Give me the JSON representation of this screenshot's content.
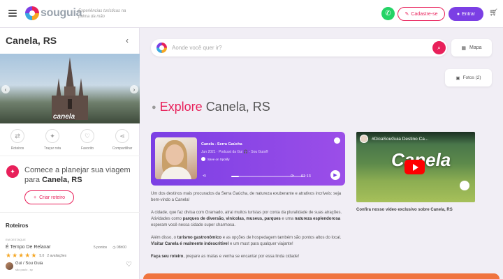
{
  "header": {
    "logo_text": "souguia",
    "tagline": "Experiências turísticas na palma da mão",
    "signup_label": "Cadastre-se",
    "login_label": "Entrar"
  },
  "sidebar": {
    "city_title": "Canela, RS",
    "hero_caption": "canela",
    "actions": [
      {
        "label": "Roteiros",
        "icon": "route-icon"
      },
      {
        "label": "Traçar rota",
        "icon": "compass-icon"
      },
      {
        "label": "Favorito",
        "icon": "heart-icon"
      },
      {
        "label": "Compartilhar",
        "icon": "share-icon"
      }
    ],
    "plan_prefix": "Comece a planejar sua viagem para ",
    "plan_city": "Canela, RS",
    "create_route_label": "Criar roteiro",
    "routes_title": "Roteiros",
    "route": {
      "highlight": "EM DESTAQUE",
      "name": "É Tempo De Relaxar",
      "points": "5 pontos",
      "duration": "08h00",
      "rating": "5.0",
      "reviews": "2 avaliações",
      "author": "Gui / Sou Guia",
      "location": "são paulo , sp"
    }
  },
  "main": {
    "search_placeholder": "Aonde você quer ir?",
    "map_label": "Mapa",
    "photos_label": "Fotos (2)",
    "explore_word": "Explore",
    "explore_city": "Canela, RS",
    "podcast": {
      "title": "Canela - Serra Gaúcha",
      "subtitle": "Jun 2021 · Podcast da Gui 🎧 - Sou Guia®",
      "save_label": "Save on Spotify",
      "duration": "01:13",
      "progress": 0.1
    },
    "video": {
      "title": "#DicaSouGuia Destino Ca...",
      "big_text": "Canela",
      "caption": "Confira nosso vídeo exclusivo sobre Canela, RS"
    },
    "description": {
      "p1": "Um dos destinos mais procurados da Serra Gaúcha, de natureza exuberante e atrativos incríveis: seja bem-vindo a Canela!",
      "p2_a": "A cidade, que faz divisa com Gramado, atrai muitos turistas por conta da pluralidade de suas atrações. Atividades como ",
      "p2_b": "parques de diversão, vinícolas, museus, parques",
      "p2_c": " e uma ",
      "p2_d": "natureza esplendorosa",
      "p2_e": " esperam você nessa cidade super charmosa.",
      "p3_a": "Além disso, o ",
      "p3_b": "turismo gastronômico",
      "p3_c": " e as opções de hospedagem também são pontos altos do local. ",
      "p3_d": "Visitar Canela é realmente indescritível",
      "p3_e": " e um must para qualquer viajante!",
      "p4_a": "Faça seu roteiro",
      "p4_b": ", prepare as malas e venha se encantar por essa linda cidade!"
    }
  },
  "colors": {
    "brand_pink": "#e8205a",
    "brand_purple": "#7b3fe4",
    "whatsapp": "#25d366"
  }
}
